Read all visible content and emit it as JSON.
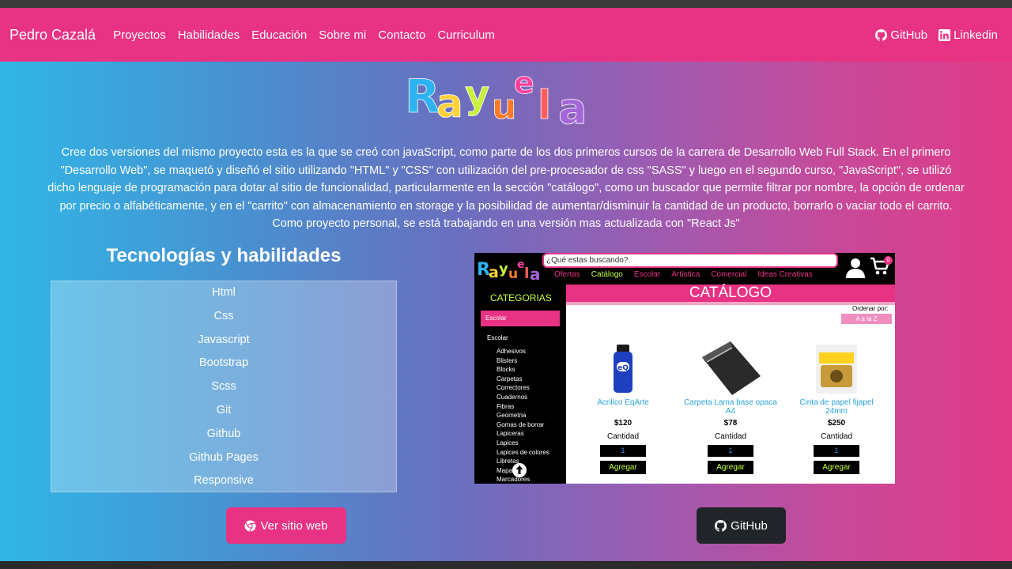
{
  "navbar": {
    "brand": "Pedro Cazalá",
    "links": [
      "Proyectos",
      "Habilidades",
      "Educación",
      "Sobre mi",
      "Contacto",
      "Curriculum"
    ],
    "github_label": "GitHub",
    "linkedin_label": "Linkedin",
    "color": "#e83283"
  },
  "project": {
    "logo_text": "Rayuela",
    "description": "Cree dos versiones del mismo proyecto esta es la que se creó con javaScript, como parte de los dos primeros cursos de la carrera de Desarrollo Web Full Stack. En el primero \"Desarrollo Web\", se maquetó y diseñó el sitio utilizando \"HTML\" y \"CSS\" con utilización del pre-procesador de css \"SASS\" y luego en el segundo curso, \"JavaScript\", se utilizó dicho lenguaje de programación para dotar al sitio de funcionalidad, particularmente en la sección \"catálogo\", como un buscador que permite filtrar por nombre, la opción de ordenar por precio o alfabéticamente, y en el \"carrito\" con almacenamiento en storage y la posibilidad de aumentar/disminuir la cantidad de un producto, borrarlo o vaciar todo el carrito. Como proyecto personal, se está trabajando en una versión mas actualizada con \"React Js\"",
    "skills_title": "Tecnologías y habilidades",
    "skills": [
      "Html",
      "Css",
      "Javascript",
      "Bootstrap",
      "Scss",
      "Git",
      "Github",
      "Github Pages",
      "Responsive"
    ],
    "web_button": "Ver sitio web",
    "github_button": "GitHub"
  },
  "preview": {
    "search_placeholder": "¿Qué estas buscando?",
    "menu": [
      "Ofertas",
      "Catálogo",
      "Escolar",
      "Artística",
      "Comercial",
      "Ideas Creativas"
    ],
    "cart_count": "0",
    "categories_title": "CATEGORIAS",
    "selected_category": "Escolar",
    "group_label": "Escolar",
    "subcategories": [
      "Adhesivos",
      "Blisters",
      "Blocks",
      "Carpetas",
      "Correctores",
      "Cuadernos",
      "Fibras",
      "Geometria",
      "Gomas de borrar",
      "Lapiceras",
      "Lapices",
      "Lapices de colores",
      "Libretas",
      "Mapas",
      "Marcadores"
    ],
    "catalog_title": "CATÁLOGO",
    "order_label": "Ordenar por:",
    "order_value": "A a la Z",
    "quantity_label": "Cantidad",
    "add_label": "Agregar",
    "products": [
      {
        "name": "Acrilico EqArte",
        "price": "$120",
        "qty": "1"
      },
      {
        "name": "Carpeta Lama base opaca A4",
        "price": "$78",
        "qty": "1"
      },
      {
        "name": "Cinta de papel fijapel 24mm",
        "price": "$250",
        "qty": "1"
      }
    ]
  }
}
